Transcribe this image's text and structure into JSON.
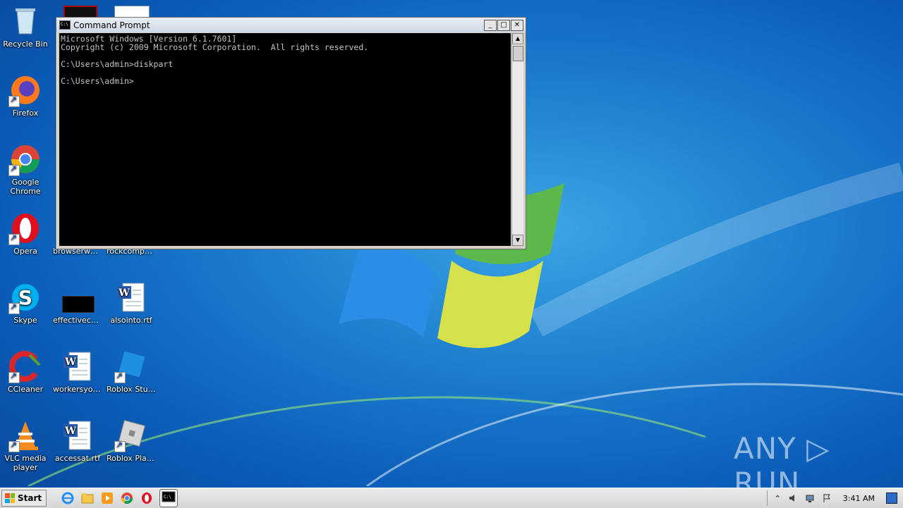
{
  "desktop": {
    "icons": [
      {
        "id": "recycle-bin",
        "label": "Recycle Bin"
      },
      {
        "id": "firefox",
        "label": "Firefox"
      },
      {
        "id": "chrome",
        "label": "Google Chrome"
      },
      {
        "id": "opera",
        "label": "Opera"
      },
      {
        "id": "skype",
        "label": "Skype"
      },
      {
        "id": "ccleaner",
        "label": "CCleaner"
      },
      {
        "id": "vlc",
        "label": "VLC media player"
      },
      {
        "id": "browserwe",
        "label": "browserwe..."
      },
      {
        "id": "rockcompar",
        "label": "rockcompar..."
      },
      {
        "id": "effectiveca",
        "label": "effectiveca..."
      },
      {
        "id": "alsointo",
        "label": "alsointo.rtf"
      },
      {
        "id": "workersyou",
        "label": "workersyou..."
      },
      {
        "id": "roblox-studio",
        "label": "Roblox Studio"
      },
      {
        "id": "accessat",
        "label": "accessat.rtf"
      },
      {
        "id": "roblox-player",
        "label": "Roblox Player"
      }
    ]
  },
  "cmd_window": {
    "title": "Command Prompt",
    "lines": [
      "Microsoft Windows [Version 6.1.7601]",
      "Copyright (c) 2009 Microsoft Corporation.  All rights reserved.",
      "",
      "C:\\Users\\admin>diskpart",
      "",
      "C:\\Users\\admin>"
    ],
    "buttons": {
      "minimize": "_",
      "maximize": "□",
      "close": "✕"
    }
  },
  "taskbar": {
    "start_label": "Start",
    "clock": "3:41 AM",
    "pinned": [
      "internet-explorer",
      "file-explorer",
      "media-player",
      "chrome",
      "opera",
      "command-prompt"
    ],
    "tray_arrow": "⌃"
  },
  "watermark": "ANY ▷ RUN"
}
